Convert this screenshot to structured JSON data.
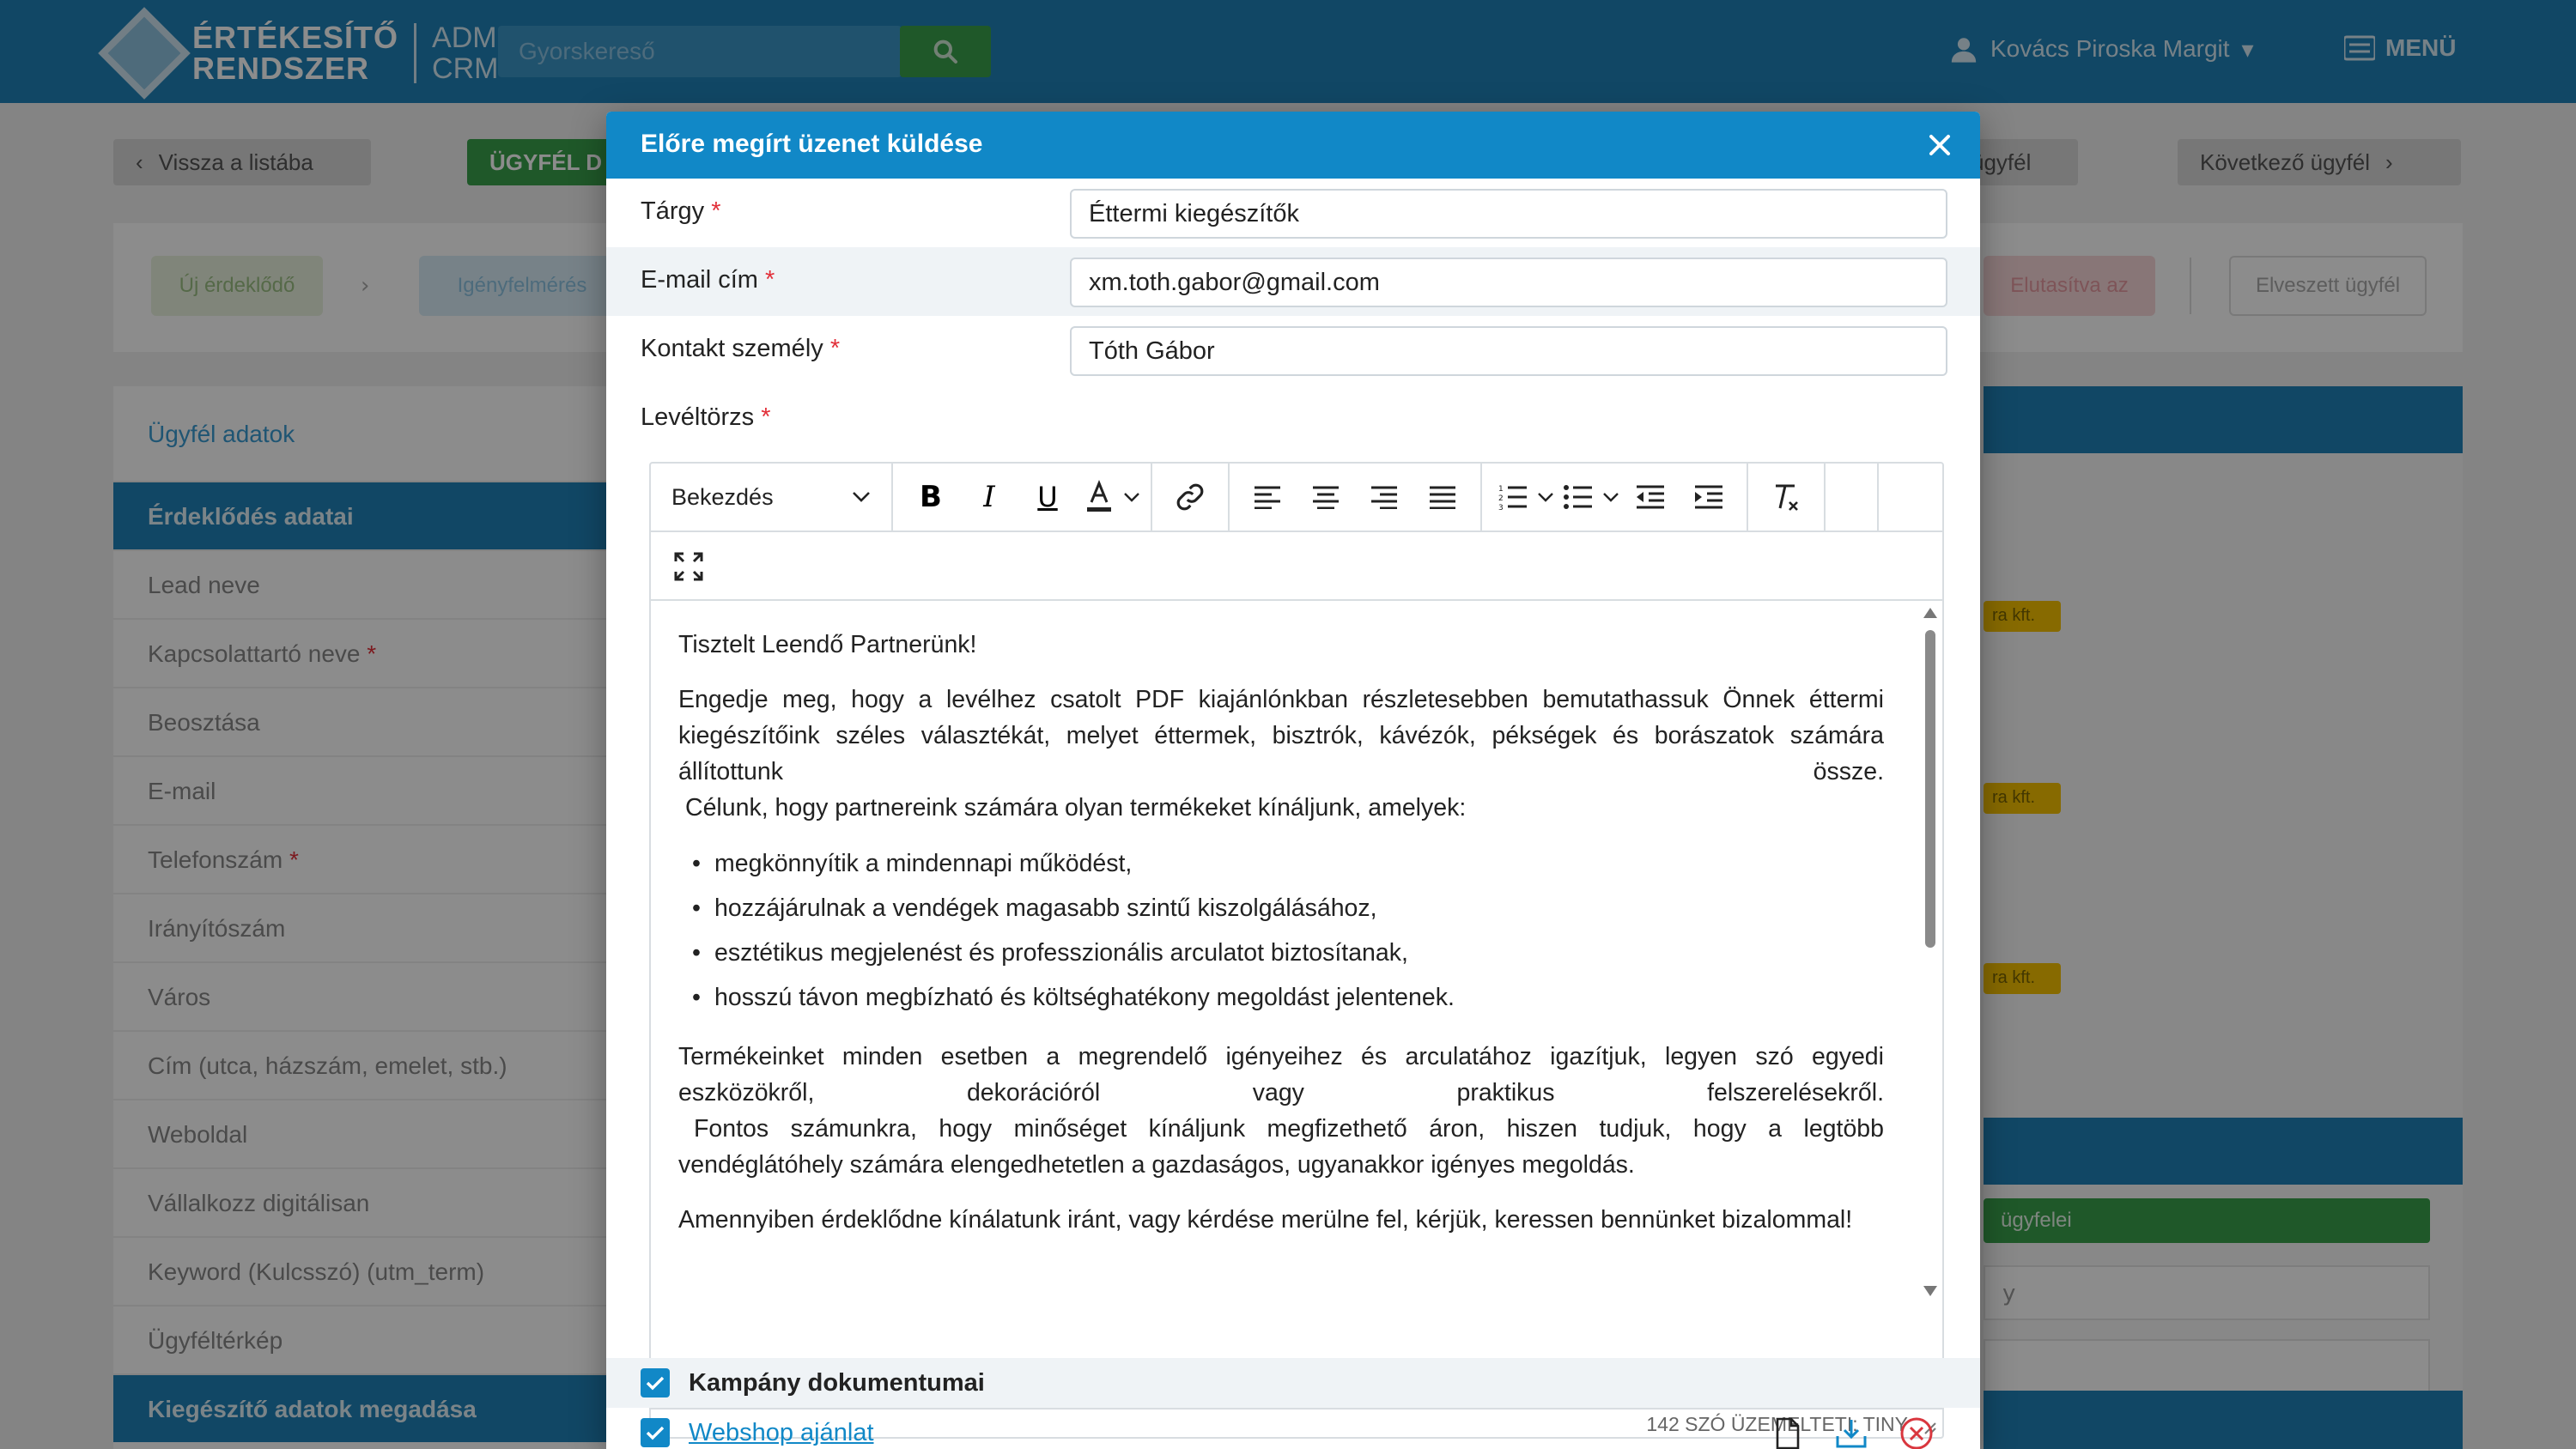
{
  "background": {
    "logo_line1": "ÉRTÉKESÍTŐ",
    "logo_line2": "RENDSZER",
    "logo_sub1": "ADM",
    "logo_sub2": "CRM",
    "search_placeholder": "Gyorskereső",
    "user_name": "Kovács Piroska Margit",
    "menu_label": "MENÜ",
    "back_button": "Vissza a listába",
    "client_button": "ÜGYFÉL D",
    "client_button_right": "ügyfél",
    "next_button": "Következő ügyfél",
    "chip1": "Új érdeklődő",
    "chip2": "Igényfelmérés",
    "chip3": "Elutasítva az",
    "chip4": "Elveszett ügyfél",
    "sidebar": {
      "header": "Ügyfél adatok",
      "items": [
        {
          "label": "Érdeklődés adatai",
          "required": false,
          "active": true
        },
        {
          "label": "Lead neve",
          "required": false
        },
        {
          "label": "Kapcsolattartó neve",
          "required": true
        },
        {
          "label": "Beosztása",
          "required": false
        },
        {
          "label": "E-mail",
          "required": false
        },
        {
          "label": "Telefonszám",
          "required": true
        },
        {
          "label": "Irányítószám",
          "required": false
        },
        {
          "label": "Város",
          "required": false
        },
        {
          "label": "Cím (utca, házszám, emelet, stb.)",
          "required": false
        },
        {
          "label": "Weboldal",
          "required": false
        },
        {
          "label": "Vállalkozz digitálisan",
          "required": false
        },
        {
          "label": "Keyword (Kulcsszó) (utm_term)",
          "required": false
        },
        {
          "label": "Ügyféltérkép",
          "required": false
        }
      ],
      "footer": "Kiegészítő adatok megadása"
    },
    "right_tag": "ra kft.",
    "right_green": "ügyfelei",
    "right_text": "y"
  },
  "modal": {
    "title": "Előre megírt üzenet küldése",
    "fields": {
      "subject": {
        "label": "Tárgy",
        "value": "Éttermi kiegészítők"
      },
      "email": {
        "label": "E-mail cím",
        "value": "xm.toth.gabor@gmail.com"
      },
      "contact": {
        "label": "Kontakt személy",
        "value": "Tóth Gábor"
      },
      "body_label": "Levéltörzs"
    },
    "editor": {
      "format_select": "Bekezdés",
      "greeting": "Tisztelt Leendő Partnerünk!",
      "para1a": "Engedje meg, hogy a levélhez csatolt PDF kiajánlónkban részletesebben bemutathassuk Önnek éttermi kiegészítőink széles választékát, melyet éttermek, bisztrók, kávézók, pékségek és borászatok számára állítottunk",
      "para1b": "össze.",
      "para1c": "Célunk, hogy partnereink számára olyan termékeket kínáljunk, amelyek:",
      "bullets": [
        "megkönnyítik a mindennapi működést,",
        "hozzájárulnak a vendégek magasabb szintű kiszolgálásához,",
        "esztétikus megjelenést és professzionális arculatot biztosítanak,",
        "hosszú távon megbízható és költséghatékony megoldást jelentenek."
      ],
      "para2a": "Termékeinket minden esetben a megrendelő igényeihez és arculatához igazítjuk, legyen szó egyedi eszközökről, dekorációról vagy praktikus felszerelésekről.",
      "para2b": "Fontos számunkra, hogy minőséget kínáljunk megfizethető áron, hiszen tudjuk, hogy a legtöbb vendéglátóhely számára elengedhetetlen a gazdaságos, ugyanakkor igényes megoldás.",
      "para3": "Amennyiben érdeklődne kínálatunk iránt, vagy kérdése merülne fel, kérjük, keressen bennünket bizalommal!",
      "status": "142 SZÓ  ÜZEMELTETI: TINY"
    },
    "documents": {
      "section_label": "Kampány dokumentumai",
      "section_checked": true,
      "file_name": "Webshop ajánlat",
      "file_checked": true
    },
    "colors": {
      "header": "#1188c7",
      "required": "#e2303a",
      "remove": "#d9363e"
    }
  }
}
